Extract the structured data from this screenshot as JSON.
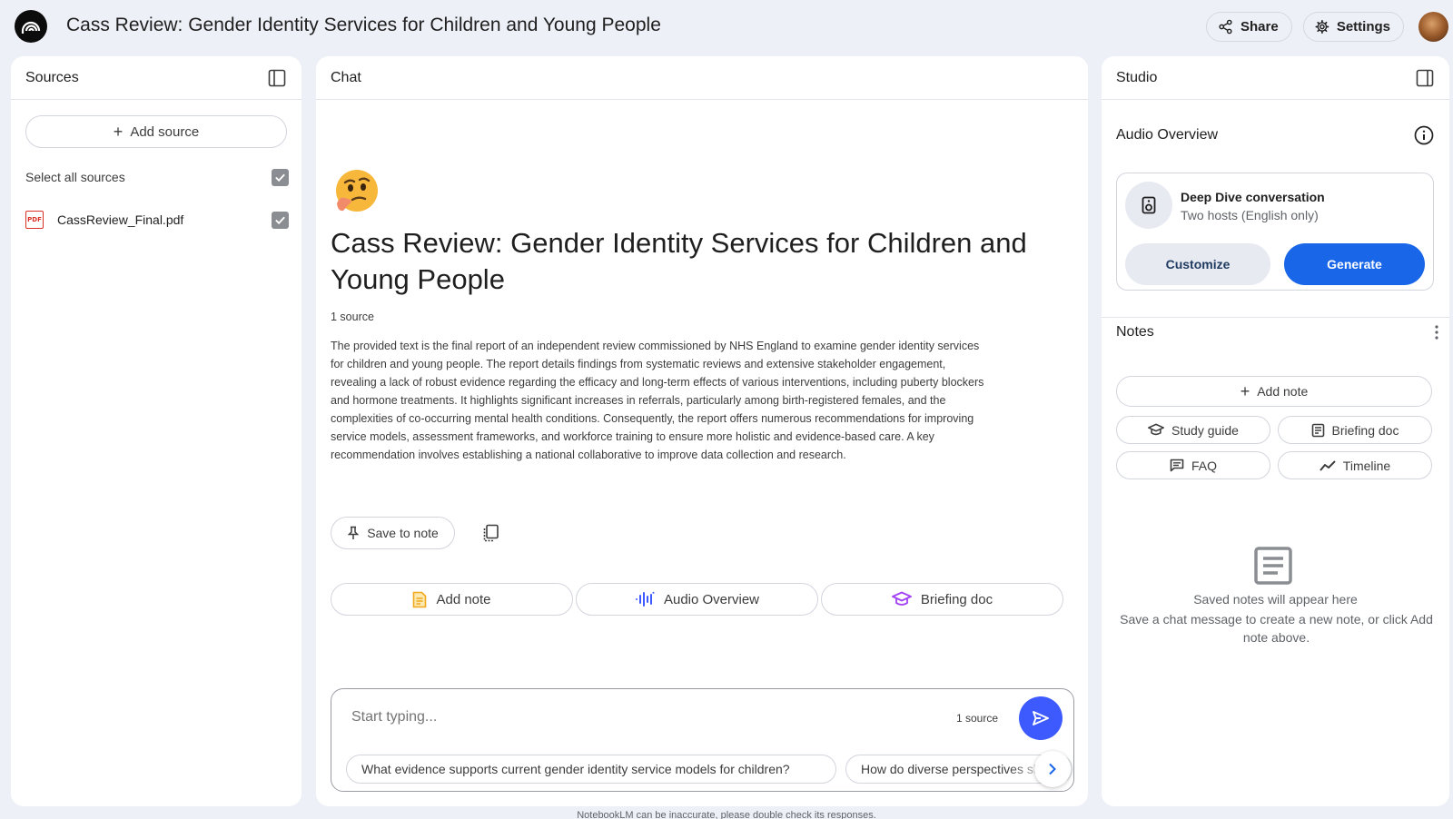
{
  "header": {
    "title": "Cass Review: Gender Identity Services for Children and Young People",
    "share_label": "Share",
    "settings_label": "Settings"
  },
  "sources": {
    "heading": "Sources",
    "add_source_label": "Add source",
    "select_all_label": "Select all sources",
    "items": [
      {
        "name": "CassReview_Final.pdf",
        "type": "PDF",
        "checked": true
      }
    ]
  },
  "chat": {
    "heading": "Chat",
    "notebook_title": "Cass Review: Gender Identity Services for Children and Young People",
    "source_count": "1 source",
    "summary": "The provided text is the final report of an independent review commissioned by NHS England to examine gender identity services for children and young people. The report details findings from systematic reviews and extensive stakeholder engagement, revealing a lack of robust evidence regarding the efficacy and long-term effects of various interventions, including puberty blockers and hormone treatments. It highlights significant increases in referrals, particularly among birth-registered females, and the complexities of co-occurring mental health conditions. Consequently, the report offers numerous recommendations for improving service models, assessment frameworks, and workforce training to ensure more holistic and evidence-based care. A key recommendation involves establishing a national collaborative to improve data collection and research.",
    "save_to_note_label": "Save to note",
    "actions": [
      {
        "label": "Add note",
        "icon": "note-icon"
      },
      {
        "label": "Audio Overview",
        "icon": "audio-wave-icon"
      },
      {
        "label": "Briefing doc",
        "icon": "graduation-cap-icon"
      }
    ],
    "composer": {
      "placeholder": "Start typing...",
      "source_count": "1 source"
    },
    "suggestions": [
      "What evidence supports current gender identity service models for children?",
      "How do diverse perspectives shape"
    ],
    "disclaimer": "NotebookLM can be inaccurate, please double check its responses."
  },
  "studio": {
    "heading": "Studio",
    "audio_overview_label": "Audio Overview",
    "audio_card": {
      "title": "Deep Dive conversation",
      "subtitle": "Two hosts (English only)",
      "customize_label": "Customize",
      "generate_label": "Generate"
    },
    "notes_label": "Notes",
    "add_note_label": "Add note",
    "tools": [
      {
        "label": "Study guide",
        "icon": "graduation-cap-icon"
      },
      {
        "label": "Briefing doc",
        "icon": "document-icon"
      },
      {
        "label": "FAQ",
        "icon": "chat-bubble-icon"
      },
      {
        "label": "Timeline",
        "icon": "trend-icon"
      }
    ],
    "empty_title": "Saved notes will appear here",
    "empty_subtitle": "Save a chat message to create a new note, or click Add note above."
  },
  "colors": {
    "background": "#eef0f8",
    "accent_blue": "#1a66e8",
    "send_button": "#3d5afe",
    "pdf_red": "#d93025"
  }
}
